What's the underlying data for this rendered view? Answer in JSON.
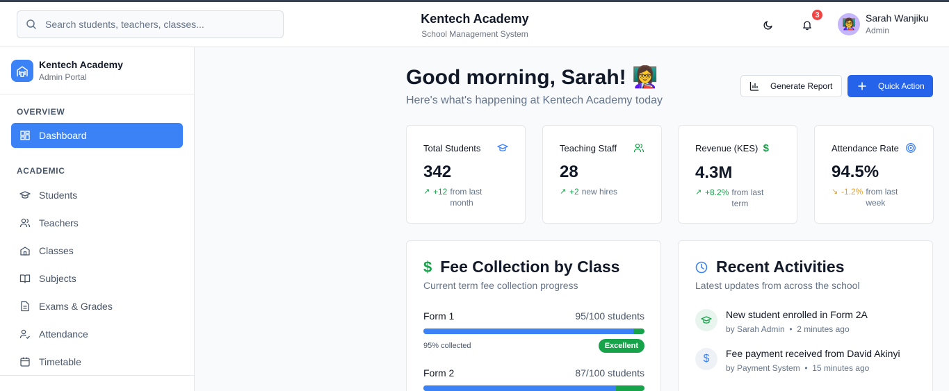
{
  "header": {
    "search_placeholder": "Search students, teachers, classes...",
    "title": "Kentech Academy",
    "subtitle": "School Management System",
    "notifications_count": "3",
    "user_name": "Sarah Wanjiku",
    "user_role": "Admin"
  },
  "sidebar": {
    "brand_name": "Kentech Academy",
    "brand_sub": "Admin Portal",
    "section_overview": "OVERVIEW",
    "dashboard": "Dashboard",
    "section_academic": "ACADEMIC",
    "items": [
      "Students",
      "Teachers",
      "Classes",
      "Subjects",
      "Exams & Grades",
      "Attendance",
      "Timetable"
    ]
  },
  "main": {
    "greeting": "Good morning, Sarah! 👩‍🏫",
    "subtext": "Here's what's happening at Kentech Academy today",
    "generate_report": "Generate Report",
    "quick_action": "Quick Action"
  },
  "stats": [
    {
      "label": "Total Students",
      "value": "342",
      "change": "+12",
      "desc": "from last month",
      "trend": "up"
    },
    {
      "label": "Teaching Staff",
      "value": "28",
      "change": "+2",
      "desc": "new hires",
      "trend": "up"
    },
    {
      "label": "Revenue (KES)",
      "value": "4.3M",
      "change": "+8.2%",
      "desc": "from last term",
      "trend": "up"
    },
    {
      "label": "Attendance Rate",
      "value": "94.5%",
      "change": "-1.2%",
      "desc": "from last week",
      "trend": "down"
    }
  ],
  "fee_card": {
    "title": "Fee Collection by Class",
    "subtitle": "Current term fee collection progress",
    "rows": [
      {
        "class": "Form 1",
        "students": "95/100 students",
        "collected": "95% collected",
        "status": "Excellent",
        "fraction": 0.95
      },
      {
        "class": "Form 2",
        "students": "87/100 students",
        "fraction": 0.87
      }
    ]
  },
  "activity_card": {
    "title": "Recent Activities",
    "subtitle": "Latest updates from across the school",
    "items": [
      {
        "text": "New student enrolled in Form 2A",
        "by": "by Sarah Admin",
        "time": "2 minutes ago"
      },
      {
        "text": "Fee payment received from David Akinyi",
        "by": "by Payment System",
        "time": "15 minutes ago"
      }
    ]
  },
  "colors": {
    "primary": "#3b82f6",
    "success": "#16a34a",
    "warning": "#f59e0b",
    "danger": "#ef4444"
  }
}
